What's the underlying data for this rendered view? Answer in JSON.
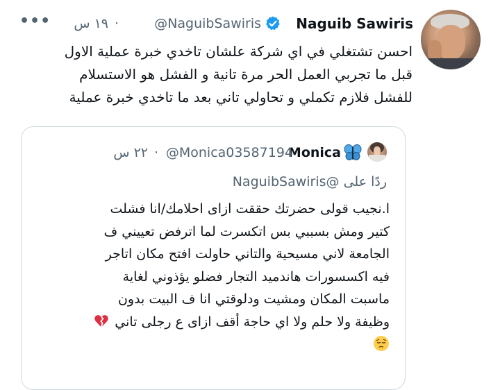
{
  "tweet": {
    "author_name": "Naguib Sawiris",
    "author_handle": "@NaguibSawiris",
    "separator": "·",
    "time": "١٩ س",
    "more_label": "•••",
    "text_lines": [
      "احسن تشتغلي في اي شركة علشان تاخدي خبرة عملية الاول",
      "قبل ما تجربي العمل الحر مرة تانية و الفشل هو الاستسلام",
      "للفشل  فلازم تكملي و تحاولي تاني بعد ما تاخدي خبرة عملية"
    ],
    "icons": {
      "verified": "verified-badge-icon",
      "avatar": "profile-photo"
    }
  },
  "quoted_tweet": {
    "author_name": "Monica",
    "author_handle": "@Monica03587194",
    "separator": "·",
    "time": "٢٢ س",
    "reply_prefix": "ردًا على",
    "reply_handle": "@NaguibSawiris",
    "text_lines": [
      "ا.نجيب قولى حضرتك حققت ازاى احلامك/انا فشلت",
      "كتير ومش بسببي بس اتكسرت لما اترفض تعييني ف",
      "الجامعة لاني مسيحية والتاني حاولت افتح مكان اتاجر",
      "فيه اكسسورات هاندميد التجار فضلو يؤذوني لغاية",
      "ماسبت المكان ومشيت ودلوقتي انا ف البيت بدون",
      "وظيفة ولا حلم ولا اي حاجة أقف ازاى ع رجلى تاني"
    ],
    "icons": {
      "name_emoji": "butterfly-emoji",
      "broken_heart": "broken-heart-emoji",
      "pensive": "pensive-face-emoji"
    }
  },
  "colors": {
    "text_primary": "#0f1419",
    "text_secondary": "#536471",
    "verified_blue": "#1d9bf0",
    "border": "#cfd9de",
    "butterfly_blue": "#4fa8e8",
    "heart_red": "#dd2e44",
    "emoji_yellow": "#ffcc4d"
  }
}
